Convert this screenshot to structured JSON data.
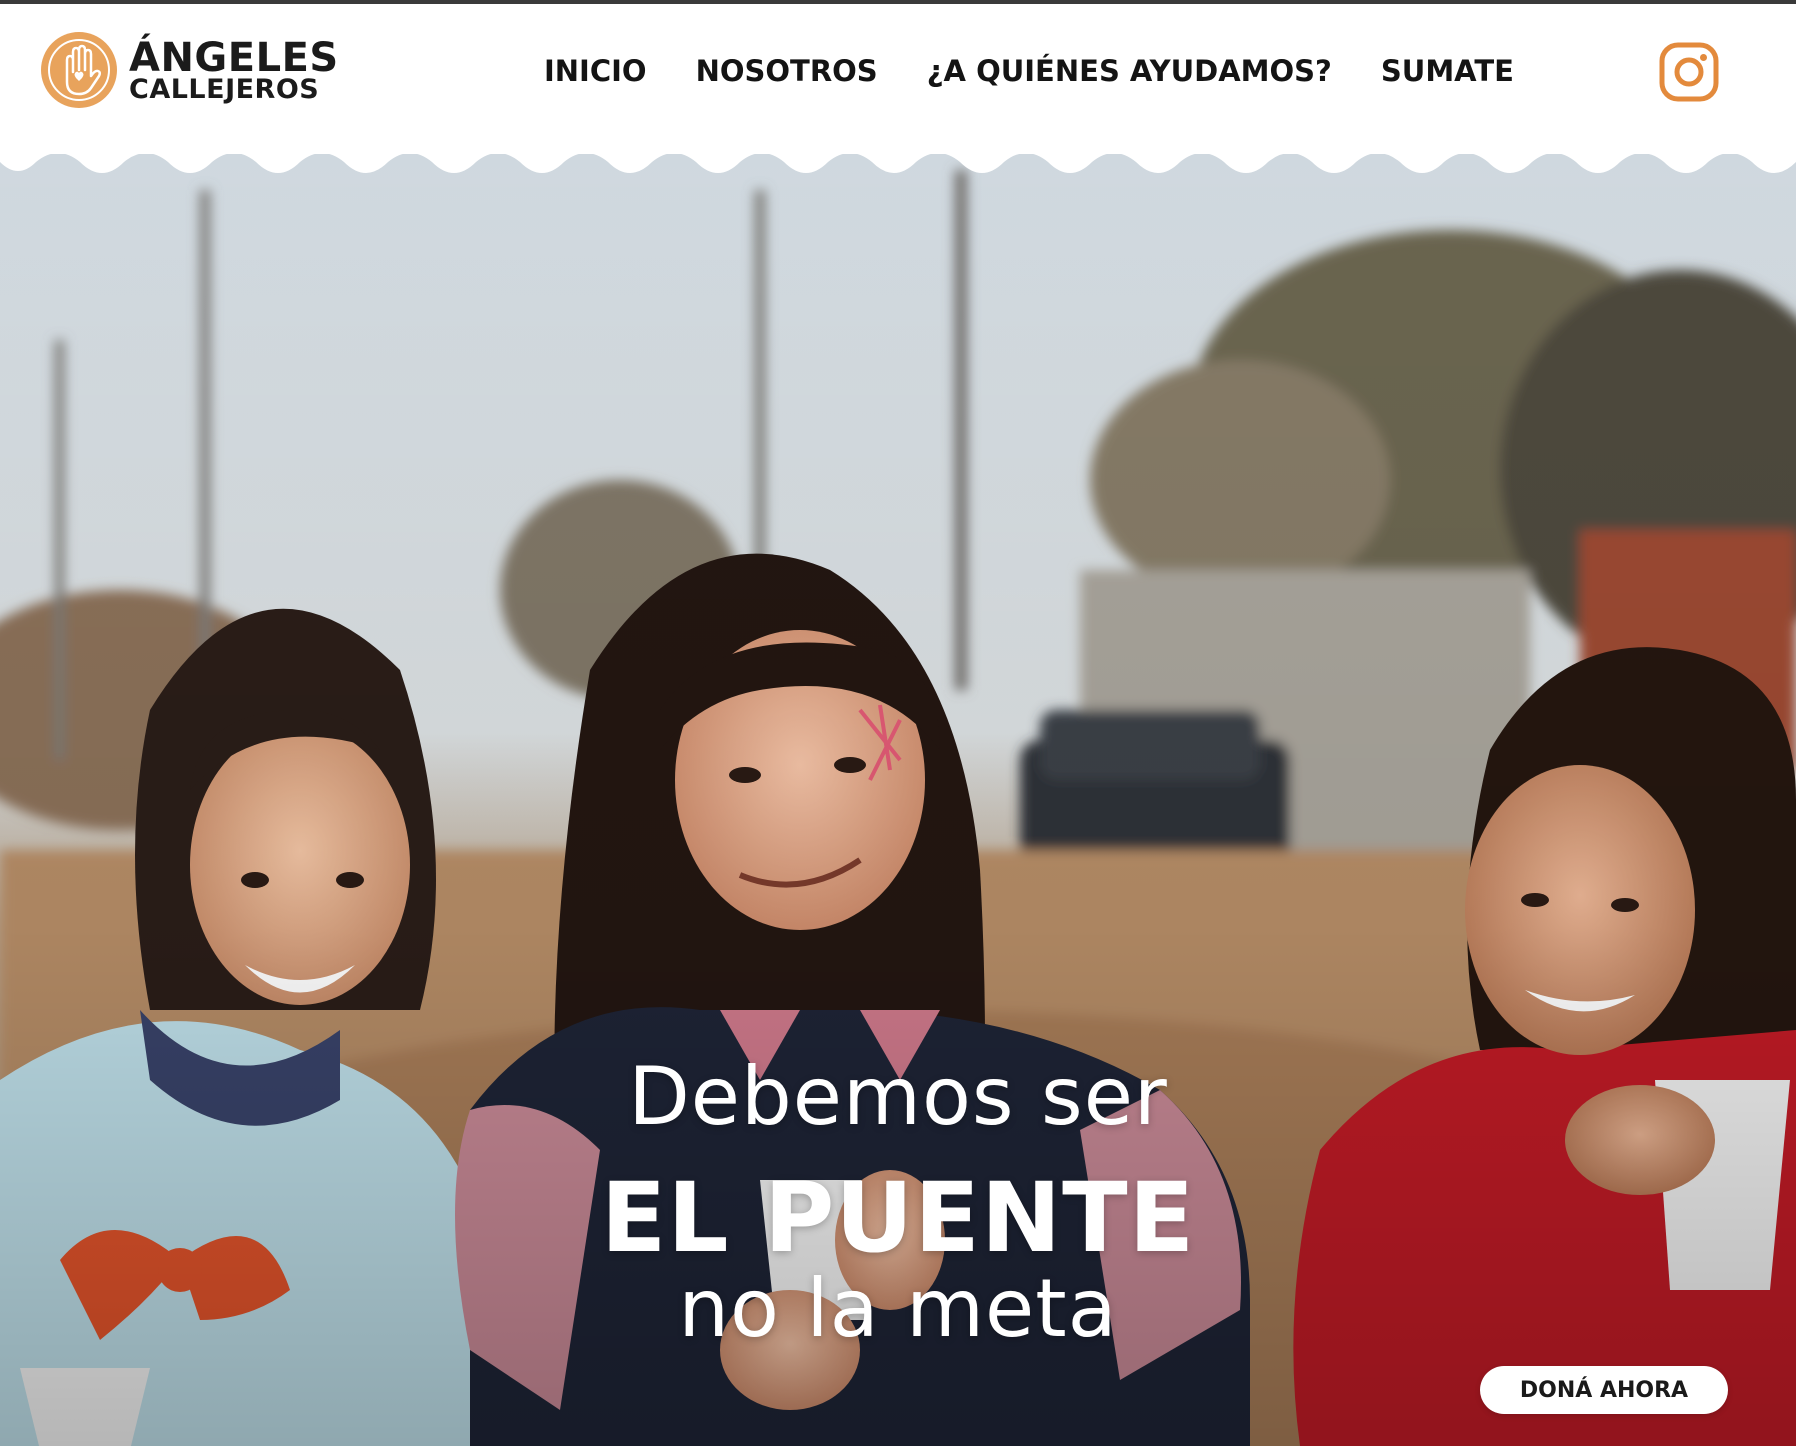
{
  "brand": {
    "line1": "ÁNGELES",
    "line2": "CALLEJEROS",
    "accent_color": "#e8a35c",
    "logo_icon": "hand-heart-icon"
  },
  "nav": {
    "items": [
      {
        "label": "INICIO"
      },
      {
        "label": "NOSOTROS"
      },
      {
        "label": "¿A QUIÉNES AYUDAMOS?"
      },
      {
        "label": "SUMATE"
      }
    ]
  },
  "social": {
    "icon": "instagram-icon",
    "color": "#e38a3c"
  },
  "hero": {
    "line1": "Debemos ser",
    "line2": "EL PUENTE",
    "line3": "no la meta",
    "image_description_icon": "hero-photo"
  },
  "cta": {
    "donate_label": "DONÁ AHORA"
  }
}
